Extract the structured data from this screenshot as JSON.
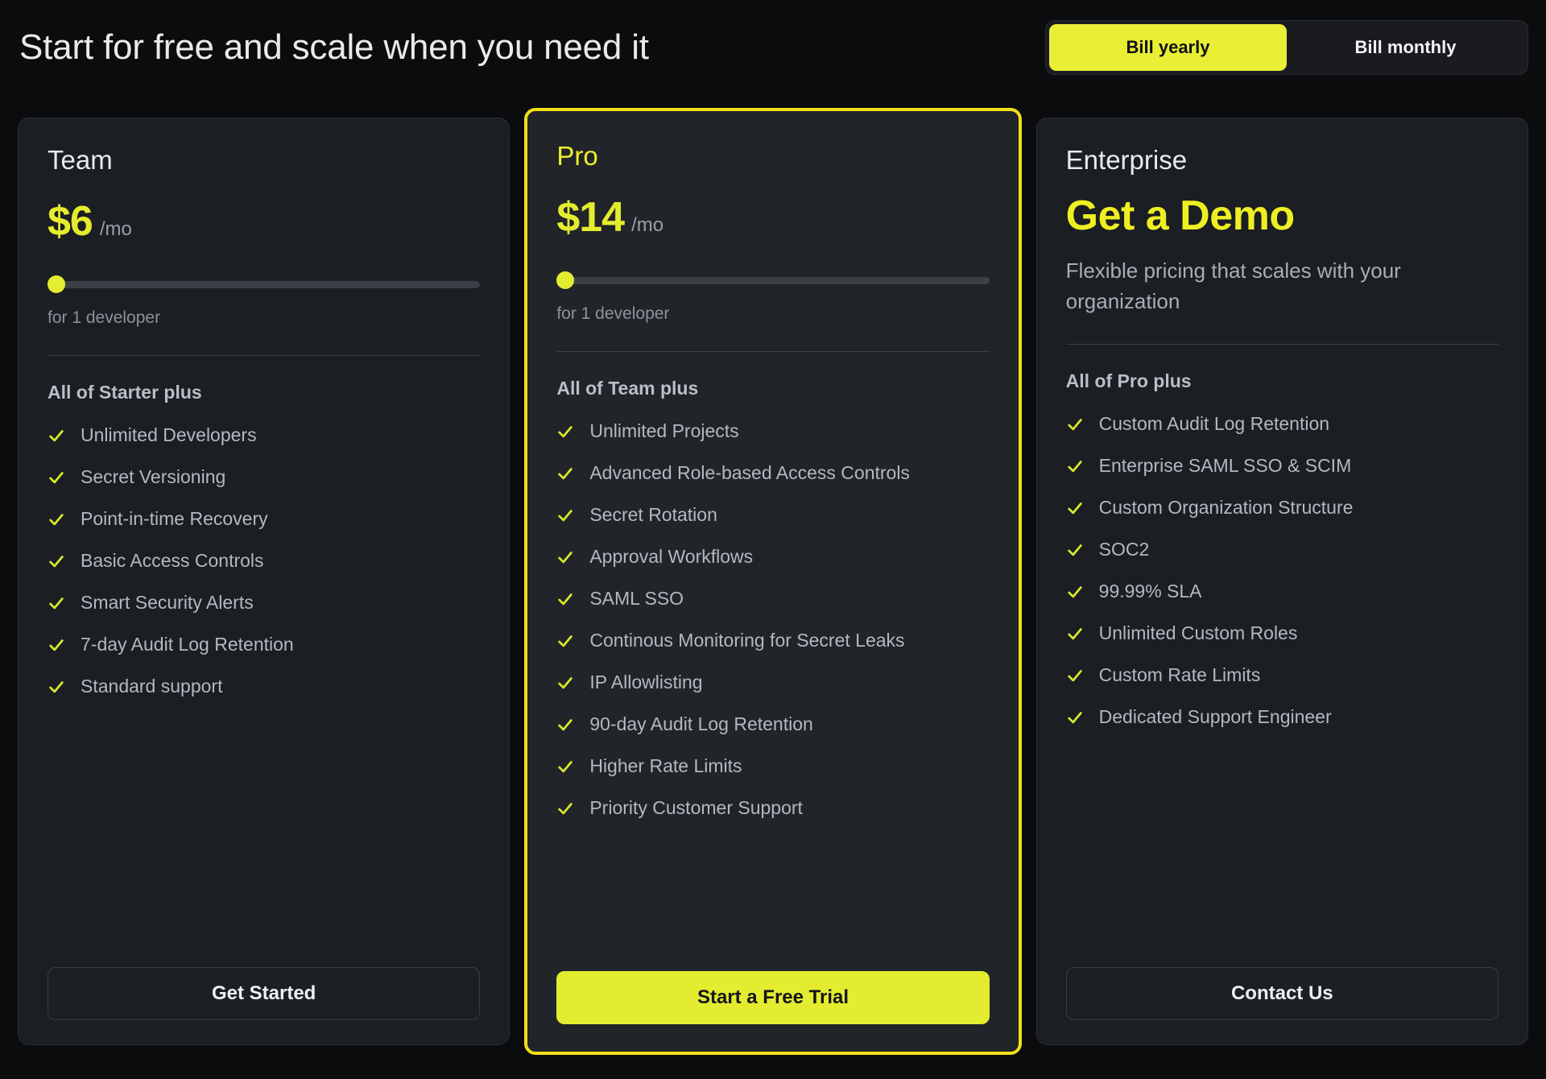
{
  "header": {
    "title": "Start for free and scale when you need it",
    "billing_toggle": {
      "yearly_label": "Bill yearly",
      "monthly_label": "Bill monthly",
      "active": "Bill yearly"
    }
  },
  "colors": {
    "page_background": "#0b0c0e",
    "card_background": "#1b1e23",
    "accent_yellow": "#e4ec2f",
    "featured_border": "#f0e016",
    "body_text": "#b3b9c1",
    "heading_text": "#e9eaec"
  },
  "plans": [
    {
      "name": "Team",
      "featured": false,
      "price": "$6",
      "price_period": "/mo",
      "slider_caption": "for 1 developer",
      "features_title": "All of Starter plus",
      "features": [
        "Unlimited Developers",
        "Secret Versioning",
        "Point-in-time Recovery",
        "Basic Access Controls",
        "Smart Security Alerts",
        "7-day Audit Log Retention",
        "Standard support"
      ],
      "cta_label": "Get Started"
    },
    {
      "name": "Pro",
      "featured": true,
      "price": "$14",
      "price_period": "/mo",
      "slider_caption": "for 1 developer",
      "features_title": "All of Team plus",
      "features": [
        "Unlimited Projects",
        "Advanced Role-based Access Controls",
        "Secret Rotation",
        "Approval Workflows",
        "SAML SSO",
        "Continous Monitoring for Secret Leaks",
        "IP Allowlisting",
        "90-day Audit Log Retention",
        "Higher Rate Limits",
        "Priority Customer Support"
      ],
      "cta_label": "Start a Free Trial"
    },
    {
      "name": "Enterprise",
      "featured": false,
      "demo_headline": "Get a Demo",
      "demo_subtitle": "Flexible pricing that scales with your organization",
      "features_title": "All of Pro plus",
      "features": [
        "Custom Audit Log Retention",
        "Enterprise SAML SSO & SCIM",
        "Custom Organization Structure",
        "SOC2",
        "99.99% SLA",
        "Unlimited Custom Roles",
        "Custom Rate Limits",
        "Dedicated Support Engineer"
      ],
      "cta_label": "Contact Us"
    }
  ]
}
